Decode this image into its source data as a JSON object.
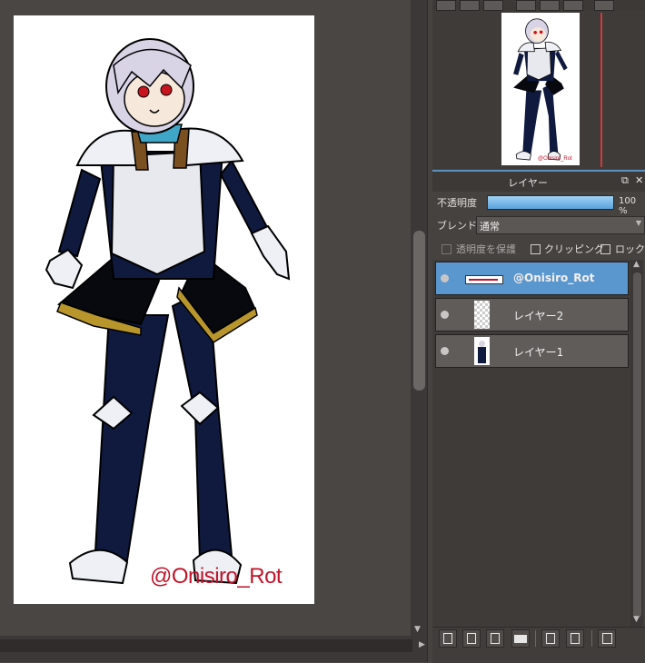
{
  "canvas": {
    "watermark": "@Onisiro_Rot"
  },
  "navigator": {
    "watermark": "@Onisiro_Rot"
  },
  "layer_panel": {
    "title": "レイヤー",
    "opacity_label": "不透明度",
    "opacity_value": "100 %",
    "opacity_fraction": 1.0,
    "blend_label": "ブレンド",
    "blend_value": "通常",
    "protect_alpha_label": "透明度を保護",
    "clipping_label": "クリッピング",
    "lock_label": "ロック",
    "layers": [
      {
        "name": "@Onisiro_Rot",
        "active": true
      },
      {
        "name": "レイヤー2",
        "active": false
      },
      {
        "name": "レイヤー1",
        "active": false
      }
    ]
  },
  "colors": {
    "accent": "#5b97cf",
    "watermark": "#c0142a",
    "armor_navy": "#0f1a3e",
    "gold": "#b8962c"
  }
}
